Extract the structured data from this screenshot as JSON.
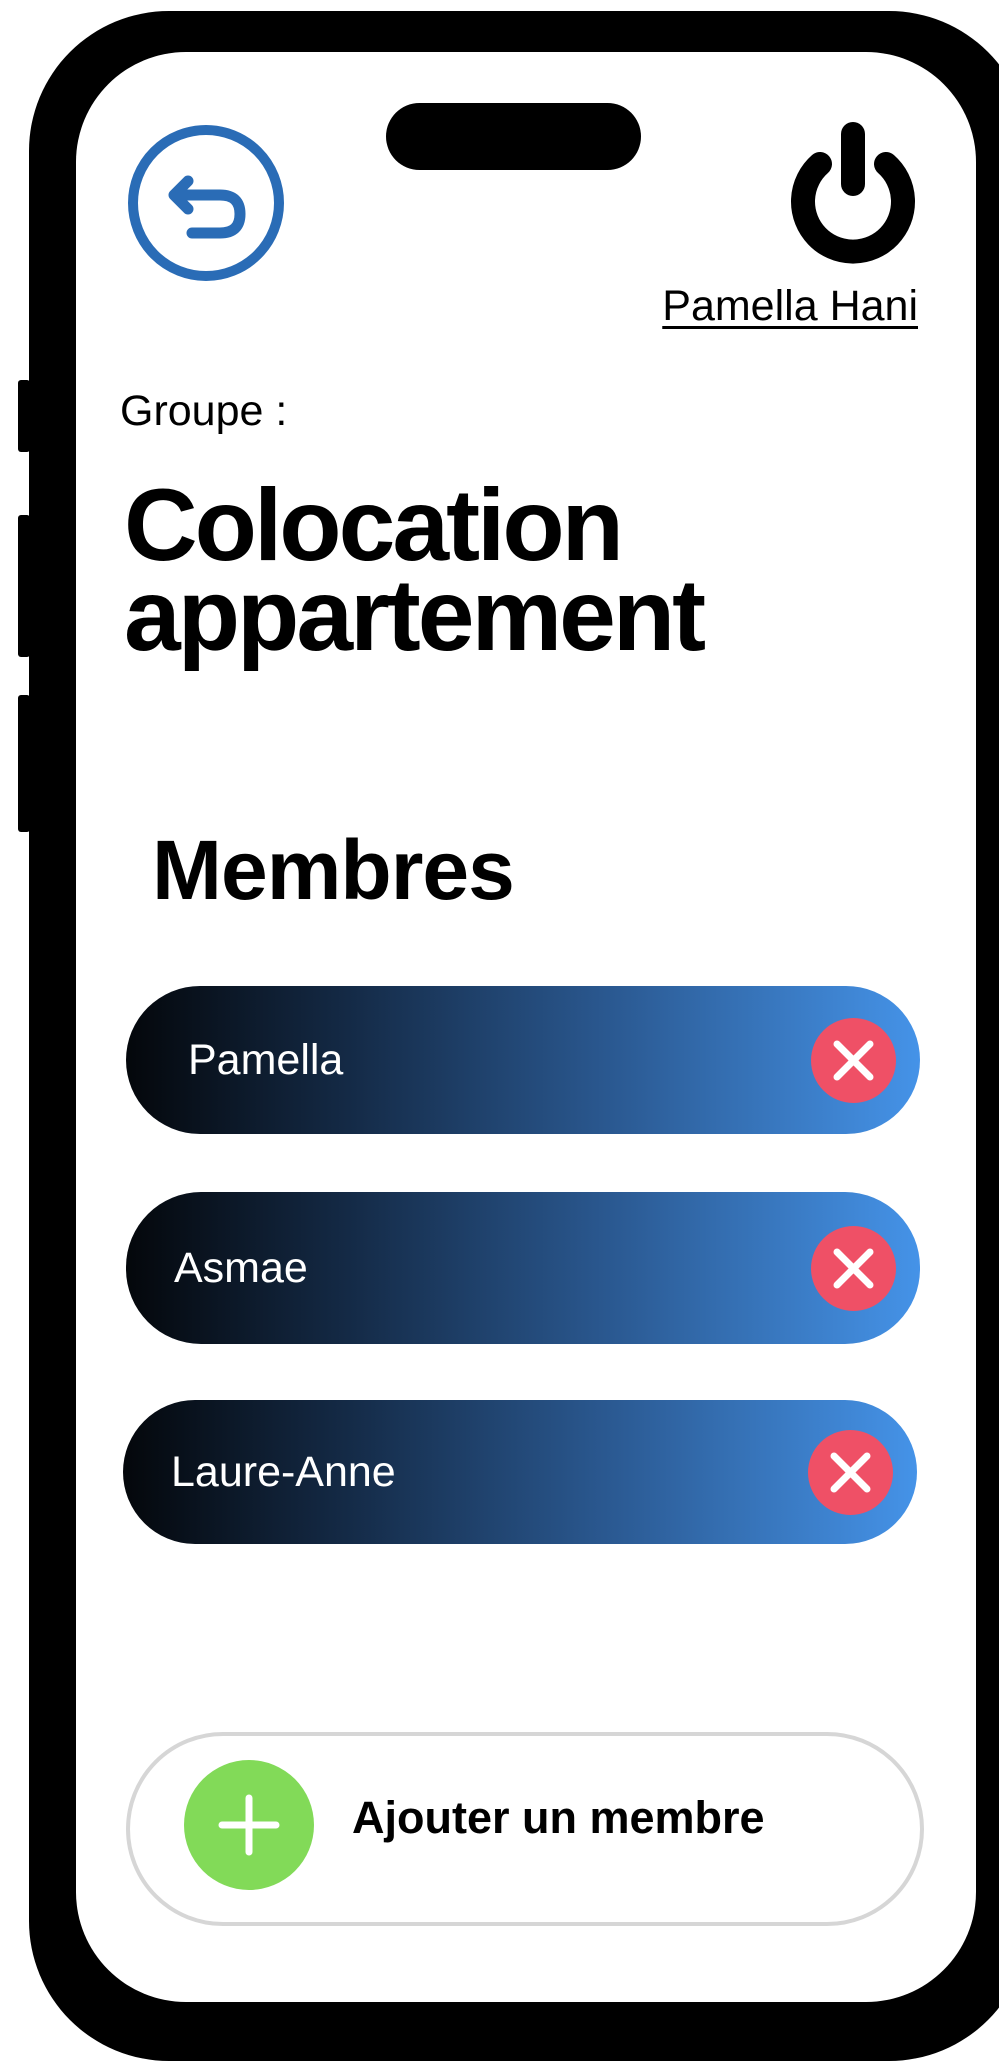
{
  "header": {
    "user_name": "Pamella Hani"
  },
  "group": {
    "label": "Groupe :",
    "title_line1": "Colocation",
    "title_line2": "appartement"
  },
  "members": {
    "heading": "Membres",
    "items": [
      {
        "name": "Pamella"
      },
      {
        "name": "Asmae"
      },
      {
        "name": "Laure-Anne"
      }
    ]
  },
  "actions": {
    "add_member_label": "Ajouter un membre"
  },
  "colors": {
    "accent_blue": "#2a6cb6",
    "remove_red": "#ef5066",
    "add_green": "#82da58",
    "gradient_start": "#04070b",
    "gradient_end": "#4593e8"
  },
  "icons": {
    "back": "undo-arrow-icon",
    "power": "power-icon",
    "remove": "close-icon",
    "add": "plus-icon"
  }
}
